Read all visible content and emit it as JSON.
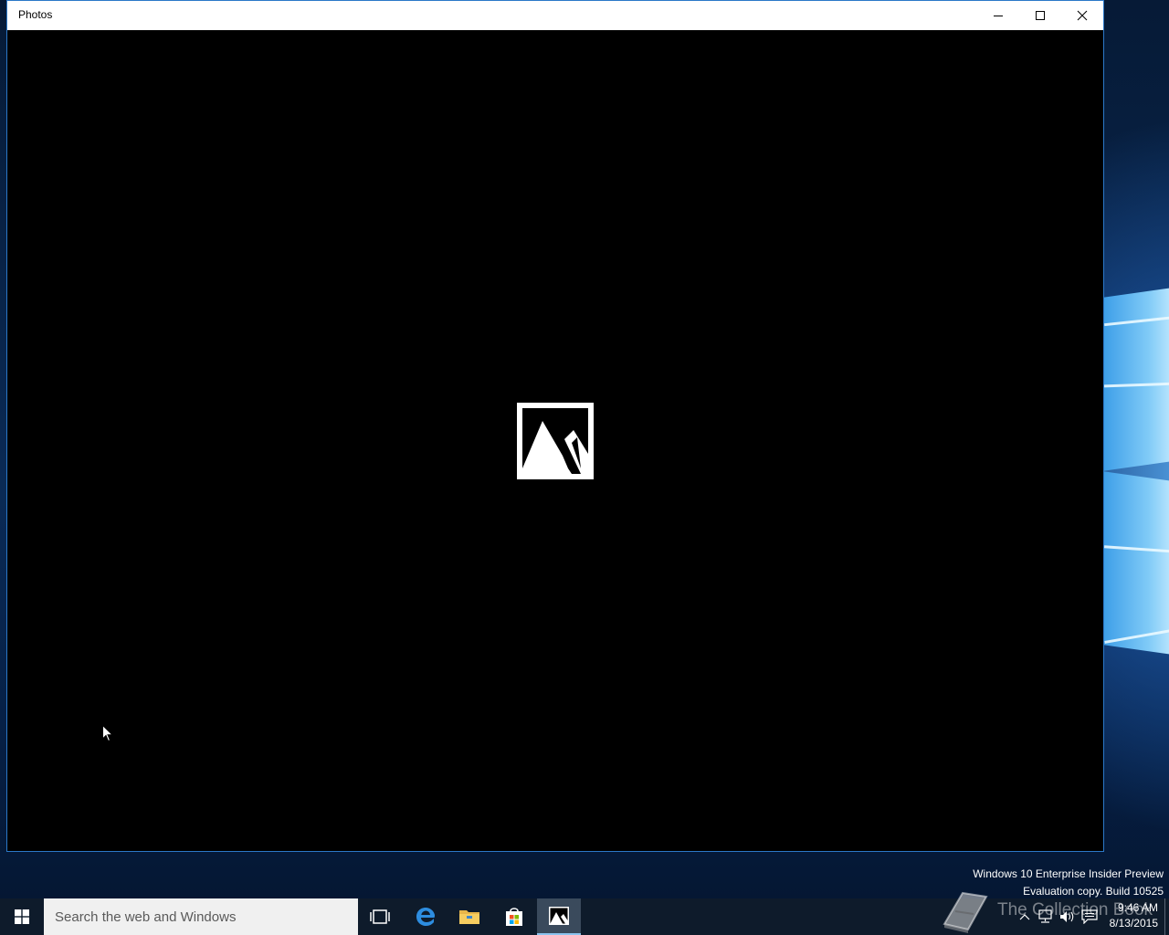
{
  "window": {
    "title": "Photos",
    "controls": {
      "minimize_icon": "minimize-icon",
      "maximize_icon": "maximize-icon",
      "close_icon": "close-icon"
    },
    "content_placeholder_icon": "photo-placeholder-icon"
  },
  "watermark": {
    "line1": "Windows 10 Enterprise Insider Preview",
    "line2": "Evaluation copy. Build 10525"
  },
  "taskbar": {
    "search_placeholder": "Search the web and Windows",
    "pinned": [
      {
        "name": "task-view",
        "icon": "task-view-icon"
      },
      {
        "name": "edge",
        "icon": "edge-icon"
      },
      {
        "name": "file-explorer",
        "icon": "folder-icon"
      },
      {
        "name": "store",
        "icon": "store-icon"
      },
      {
        "name": "photos",
        "icon": "photos-icon",
        "active": true
      }
    ],
    "tray": {
      "time": "9:46 AM",
      "date": "8/13/2015"
    }
  },
  "overlay": {
    "site_text": "The Collection Book"
  },
  "colors": {
    "taskbar": "#0e1b2b",
    "window_border": "#2b78c8",
    "accent": "#8bc3ee"
  }
}
